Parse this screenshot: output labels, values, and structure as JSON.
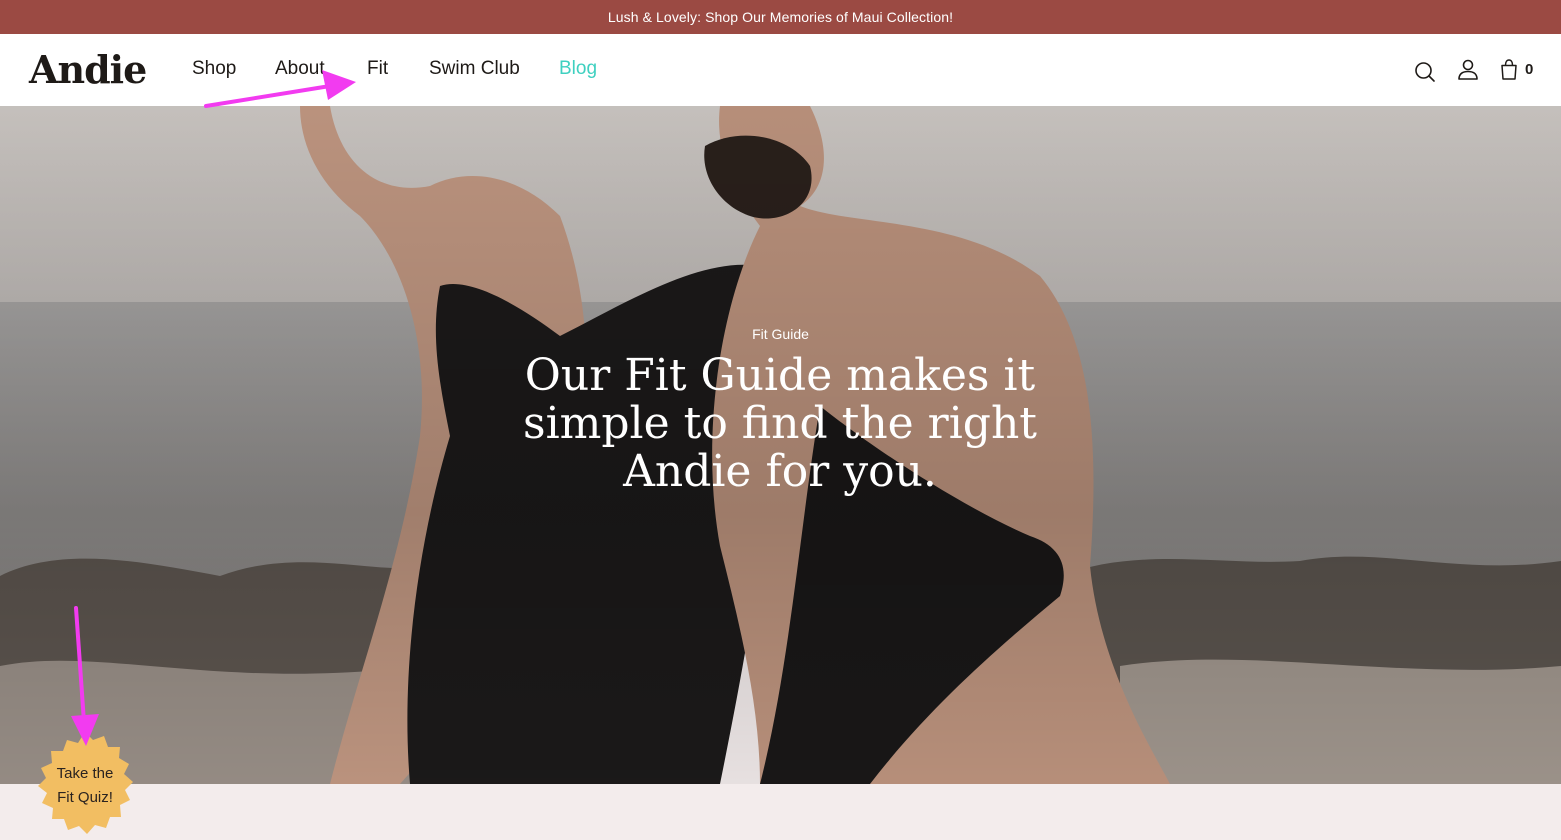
{
  "announcement": {
    "text": "Lush & Lovely: Shop Our Memories of Maui Collection!",
    "background": "#9b4a43"
  },
  "header": {
    "logo": "Andie",
    "nav": [
      {
        "label": "Shop"
      },
      {
        "label": "About"
      },
      {
        "label": "Fit"
      },
      {
        "label": "Swim Club"
      },
      {
        "label": "Blog",
        "active": true
      }
    ],
    "accent_color": "#3fd0c0",
    "icons": [
      "search-icon",
      "account-icon",
      "cart-icon"
    ],
    "cart_count": "0"
  },
  "hero": {
    "eyebrow": "Fit Guide",
    "heading": "Our Fit Guide makes it simple to find the right Andie for you."
  },
  "quiz_badge": {
    "label_line1": "Take the",
    "label_line2": "Fit Quiz!",
    "color": "#f2be62"
  },
  "annotation_color": "#f23bf0"
}
